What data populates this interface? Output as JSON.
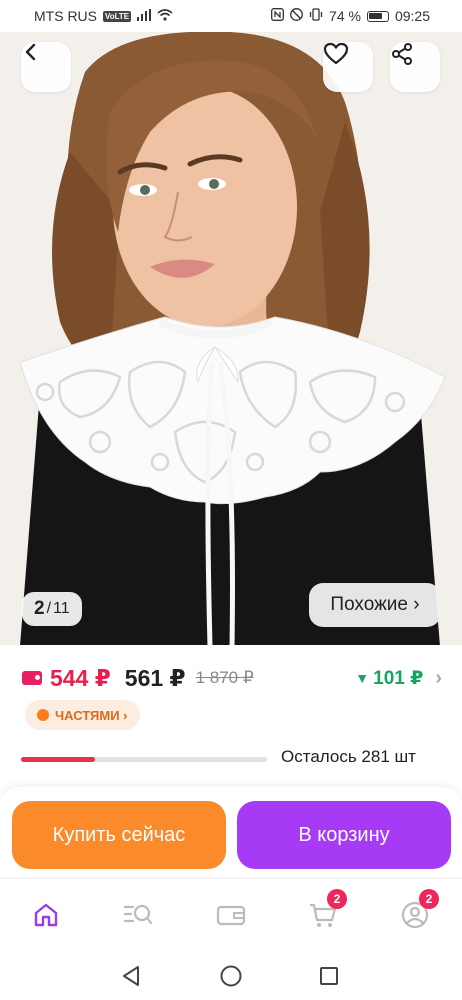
{
  "status_bar": {
    "carrier": "MTS RUS",
    "network_badge": "VoLTE",
    "battery": "74 %",
    "time": "09:25"
  },
  "hero": {
    "counter_current": "2",
    "counter_separator": "/",
    "counter_total": "11",
    "similar_label": "Похожие ›"
  },
  "price": {
    "card_price": "544 ₽",
    "price": "561 ₽",
    "old_price": "1 870 ₽",
    "cashback": "101 ₽",
    "cashback_arrow": "▼"
  },
  "installments": {
    "label": "ЧАСТЯМИ ›"
  },
  "stock": {
    "label": "Осталось 281 шт",
    "sold_fraction": 0.3
  },
  "actions": {
    "buy_now": "Купить сейчас",
    "add_to_cart": "В корзину"
  },
  "tabbar": {
    "cart_badge": "2",
    "profile_badge": "2"
  },
  "colors": {
    "accent_orange": "#fa8a2a",
    "accent_purple": "#a73bf5",
    "price_red": "#e91e4f",
    "cashback_green": "#1aa260",
    "badge_pink": "#f0255a"
  }
}
